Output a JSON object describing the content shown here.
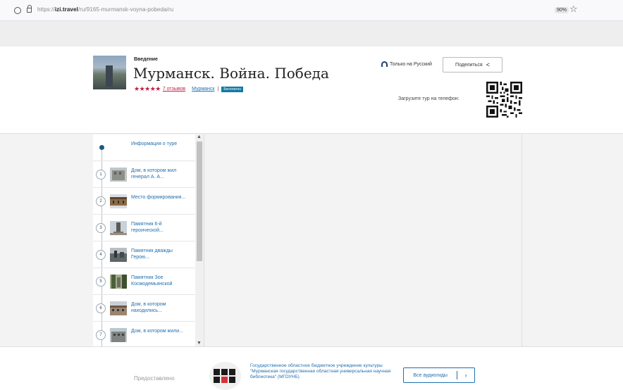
{
  "browser": {
    "url_prefix": "https://",
    "url_domain": "izi.travel",
    "url_path": "/ru/9165-murmansk-voyna-pobeda/ru",
    "zoom": "90%"
  },
  "header": {
    "kicker": "Введение",
    "title": "Мурманск. Война. Победа",
    "stars": "★★★★★",
    "reviews": "7 отзывов",
    "city": "Мурманск",
    "separator": "|",
    "price_badge": "Бесплатно",
    "language": "Только на Русский",
    "share_label": "Поделиться",
    "qr_label": "Загрузите тур на телефон:"
  },
  "sidebar": {
    "items": [
      {
        "num": "",
        "label": "Информация о туре"
      },
      {
        "num": "1",
        "label": "Дом, в котором жил генерал А. А..."
      },
      {
        "num": "2",
        "label": "Место формирования..."
      },
      {
        "num": "3",
        "label": "Памятник 6-й героической..."
      },
      {
        "num": "4",
        "label": "Памятник дважды Герою..."
      },
      {
        "num": "5",
        "label": "Памятник Зое Космодемьянской"
      },
      {
        "num": "6",
        "label": "Дом, в котором находились..."
      },
      {
        "num": "7",
        "label": "Дом, в котором жили..."
      }
    ]
  },
  "footer": {
    "provided_by": "Предоставлено",
    "org": "Государственное областное бюджетное учреждение культуры \"Мурманская государственная областная универсальная научная библиотека\" (МГОУНБ)",
    "all_guides": "Все аудиогиды",
    "arrow": "›"
  }
}
